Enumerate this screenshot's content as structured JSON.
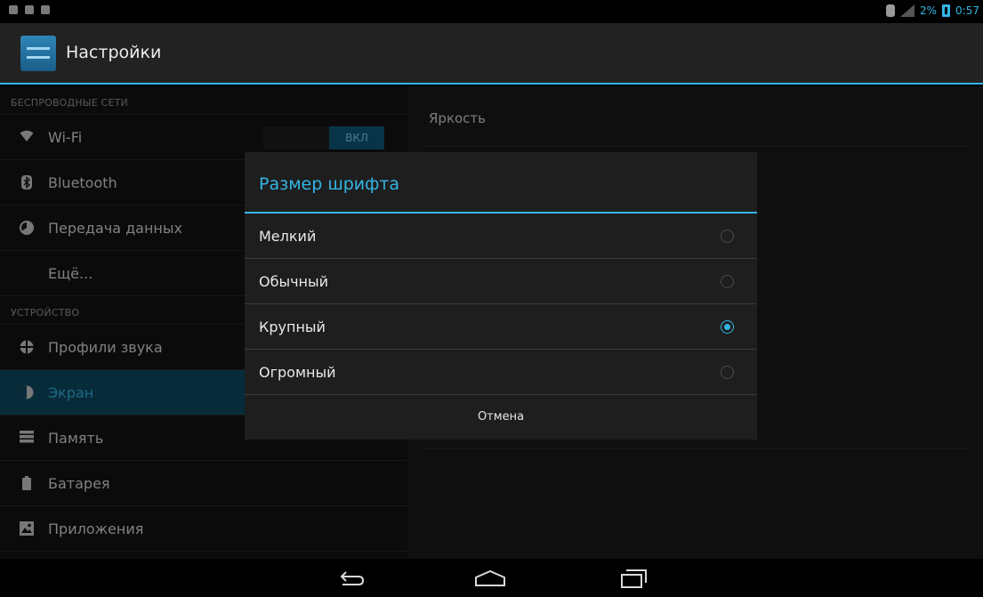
{
  "status_bar": {
    "battery": "2%",
    "time": "0:57"
  },
  "action_bar": {
    "title": "Настройки"
  },
  "sidebar": {
    "sections": [
      {
        "header": "БЕСПРОВОДНЫЕ СЕТИ"
      },
      {
        "header": "УСТРОЙСТВО"
      }
    ],
    "items": [
      {
        "label": "Wi-Fi",
        "icon": "wifi-icon"
      },
      {
        "label": "Bluetooth",
        "icon": "bluetooth-icon"
      },
      {
        "label": "Передача данных",
        "icon": "data-usage-icon"
      },
      {
        "label": "Ещё..."
      },
      {
        "label": "Профили звука",
        "icon": "sound-icon"
      },
      {
        "label": "Экран",
        "icon": "display-icon",
        "selected": true
      },
      {
        "label": "Память",
        "icon": "storage-icon"
      },
      {
        "label": "Батарея",
        "icon": "battery-icon"
      },
      {
        "label": "Приложения",
        "icon": "apps-icon"
      }
    ],
    "wifi_toggle": "ВКЛ"
  },
  "right_pane": {
    "brightness": "Яркость"
  },
  "dialog": {
    "title": "Размер шрифта",
    "options": [
      {
        "label": "Мелкий",
        "checked": false
      },
      {
        "label": "Обычный",
        "checked": false
      },
      {
        "label": "Крупный",
        "checked": true
      },
      {
        "label": "Огромный",
        "checked": false
      }
    ],
    "cancel": "Отмена"
  },
  "colors": {
    "accent": "#33b5e5",
    "selected_bg": "#0f4b64"
  }
}
